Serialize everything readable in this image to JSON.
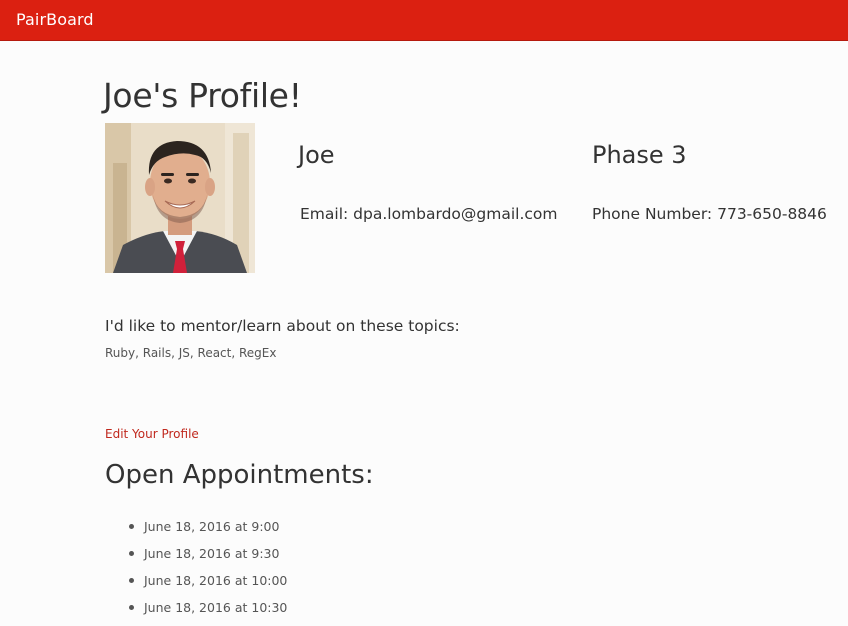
{
  "navbar": {
    "brand": "PairBoard"
  },
  "profile": {
    "title": "Joe's Profile!",
    "photo_alt": "profile-photo",
    "name": "Joe",
    "phase": "Phase 3",
    "email_label": "Email: ",
    "email": "dpa.lombardo@gmail.com",
    "phone_label": "Phone Number: ",
    "phone": "773-650-8846"
  },
  "topics": {
    "heading": "I'd like to mentor/learn about on these topics:",
    "list": "Ruby, Rails, JS, React, RegEx"
  },
  "edit_link": "Edit Your Profile",
  "appointments": {
    "heading": "Open Appointments:",
    "items": [
      "June 18, 2016 at 9:00",
      "June 18, 2016 at 9:30",
      "June 18, 2016 at 10:00",
      "June 18, 2016 at 10:30"
    ]
  },
  "colors": {
    "navbar_bg": "#db2011",
    "link": "#c0281d",
    "text": "#333333"
  }
}
